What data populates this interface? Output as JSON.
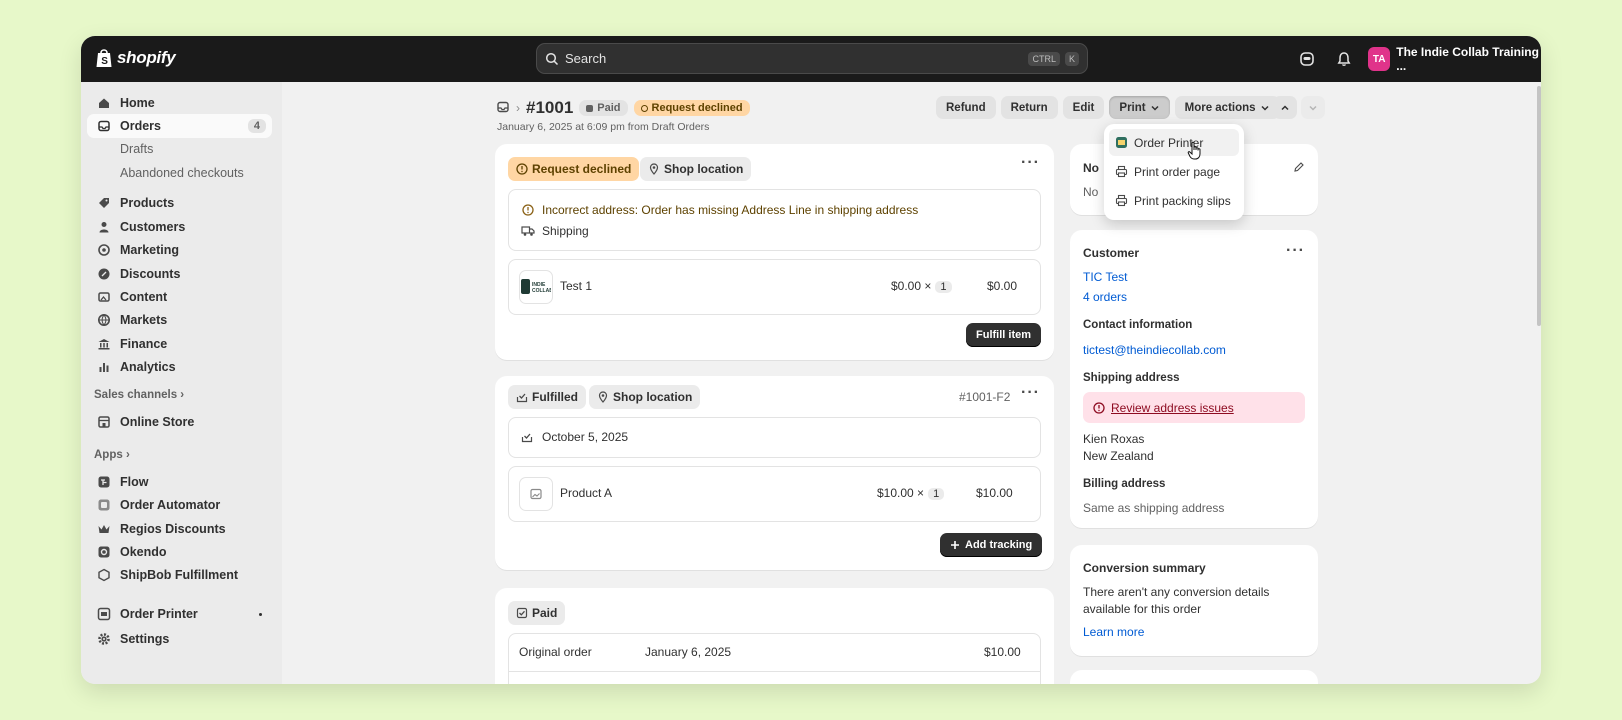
{
  "topbar": {
    "logo_text": "shopify",
    "search_placeholder": "Search",
    "kbd1": "CTRL",
    "kbd2": "K",
    "avatar_initials": "TA",
    "store_name": "The Indie Collab Training ..."
  },
  "sidebar": {
    "home": "Home",
    "orders": "Orders",
    "orders_count": "4",
    "drafts": "Drafts",
    "abandoned": "Abandoned checkouts",
    "products": "Products",
    "customers": "Customers",
    "marketing": "Marketing",
    "discounts": "Discounts",
    "content": "Content",
    "markets": "Markets",
    "finance": "Finance",
    "analytics": "Analytics",
    "sales_channels": "Sales channels",
    "online_store": "Online Store",
    "apps": "Apps",
    "flow": "Flow",
    "order_automator": "Order Automator",
    "regios": "Regios Discounts",
    "okendo": "Okendo",
    "shipbob": "ShipBob Fulfillment",
    "order_printer": "Order Printer",
    "settings": "Settings"
  },
  "header": {
    "order_number": "#1001",
    "status_paid": "Paid",
    "status_declined": "Request declined",
    "subtitle": "January 6, 2025 at 6:09 pm from Draft Orders",
    "refund": "Refund",
    "return": "Return",
    "edit": "Edit",
    "print": "Print",
    "more_actions": "More actions"
  },
  "print_menu": {
    "order_printer": "Order Printer",
    "print_order_page": "Print order page",
    "print_packing_slips": "Print packing slips"
  },
  "card1": {
    "badge_declined": "Request declined",
    "badge_location": "Shop location",
    "warning": "Incorrect address: Order has missing Address Line in shipping address",
    "shipping": "Shipping",
    "item_name": "Test 1",
    "item_price": "$0.00",
    "item_qty": "1",
    "item_total": "$0.00",
    "times": "×",
    "fulfill_btn": "Fulfill item"
  },
  "card2": {
    "badge_fulfilled": "Fulfilled",
    "badge_location": "Shop location",
    "fulfillment_id": "#1001-F2",
    "date": "October 5, 2025",
    "item_name": "Product A",
    "item_price": "$10.00",
    "item_qty": "1",
    "item_total": "$10.00",
    "times": "×",
    "tracking_btn": "Add tracking"
  },
  "card3": {
    "badge_paid": "Paid",
    "row_label": "Original order",
    "row_date": "January 6, 2025",
    "row_amount": "$10.00"
  },
  "notes": {
    "title_partial": "No",
    "text_partial": "No"
  },
  "customer": {
    "title": "Customer",
    "name": "TIC Test",
    "orders": "4 orders",
    "contact_label": "Contact information",
    "email": "tictest@theindiecollab.com",
    "shipping_label": "Shipping address",
    "review_link": "Review address issues",
    "addr_line1": "Kien Roxas",
    "addr_line2": "New Zealand",
    "billing_label": "Billing address",
    "billing_value": "Same as shipping address"
  },
  "conversion": {
    "title": "Conversion summary",
    "text1": "There aren't any conversion details",
    "text2": "available for this order",
    "learn_more": "Learn more"
  },
  "colors": {
    "accent_link": "#005bd3",
    "declined_bg": "#ffd6a4",
    "alert_bg": "#ffe1e9"
  }
}
